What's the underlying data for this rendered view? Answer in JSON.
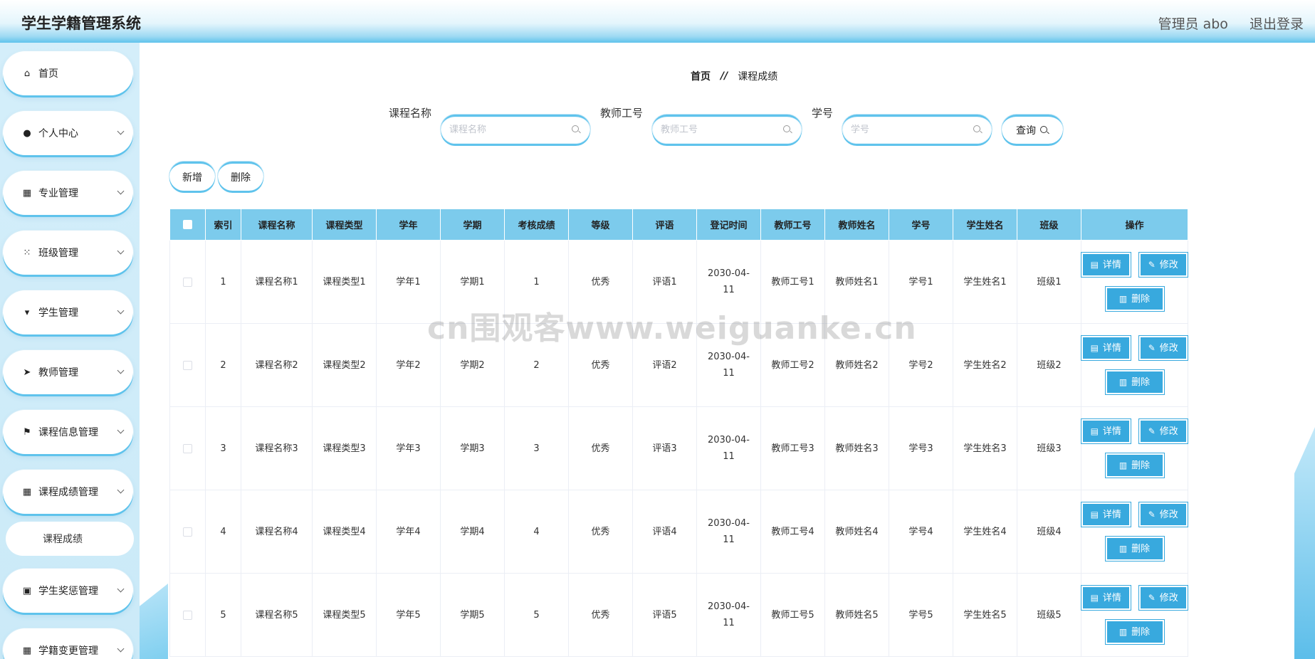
{
  "header": {
    "title": "学生学籍管理系统",
    "user_label": "管理员 abo",
    "logout_label": "退出登录"
  },
  "sidebar": {
    "items": [
      {
        "label": "首页",
        "icon": "home-icon",
        "has_submenu": false
      },
      {
        "label": "个人中心",
        "icon": "user-icon",
        "has_submenu": true
      },
      {
        "label": "专业管理",
        "icon": "grid-icon",
        "has_submenu": true
      },
      {
        "label": "班级管理",
        "icon": "grid-dots-icon",
        "has_submenu": true
      },
      {
        "label": "学生管理",
        "icon": "sign-icon",
        "has_submenu": true
      },
      {
        "label": "教师管理",
        "icon": "send-icon",
        "has_submenu": true
      },
      {
        "label": "课程信息管理",
        "icon": "flag-icon",
        "has_submenu": true
      },
      {
        "label": "课程成绩管理",
        "icon": "grid-icon",
        "has_submenu": true
      },
      {
        "label": "学生奖惩管理",
        "icon": "clipboard-icon",
        "has_submenu": true
      },
      {
        "label": "学籍变更管理",
        "icon": "grid-icon",
        "has_submenu": true
      }
    ],
    "active_sub": {
      "label": "课程成绩"
    }
  },
  "breadcrumb": {
    "home": "首页",
    "separator": "//",
    "current": "课程成绩"
  },
  "search": {
    "course_name": {
      "label": "课程名称",
      "placeholder": "课程名称",
      "value": ""
    },
    "teacher_id": {
      "label": "教师工号",
      "placeholder": "教师工号",
      "value": ""
    },
    "student_id": {
      "label": "学号",
      "placeholder": "学号",
      "value": ""
    },
    "query_label": "查询"
  },
  "actions": {
    "add_label": "新增",
    "delete_label": "删除"
  },
  "table": {
    "columns": [
      "索引",
      "课程名称",
      "课程类型",
      "学年",
      "学期",
      "考核成绩",
      "等级",
      "评语",
      "登记时间",
      "教师工号",
      "教师姓名",
      "学号",
      "学生姓名",
      "班级",
      "操作"
    ],
    "rows": [
      {
        "index": "1",
        "course": "课程名称1",
        "type": "课程类型1",
        "year": "学年1",
        "term": "学期1",
        "score": "1",
        "grade": "优秀",
        "comment": "评语1",
        "date_a": "2030-04-",
        "date_b": "11",
        "tid": "教师工号1",
        "tname": "教师姓名1",
        "sid": "学号1",
        "sname": "学生姓名1",
        "cls": "班级1"
      },
      {
        "index": "2",
        "course": "课程名称2",
        "type": "课程类型2",
        "year": "学年2",
        "term": "学期2",
        "score": "2",
        "grade": "优秀",
        "comment": "评语2",
        "date_a": "2030-04-",
        "date_b": "11",
        "tid": "教师工号2",
        "tname": "教师姓名2",
        "sid": "学号2",
        "sname": "学生姓名2",
        "cls": "班级2"
      },
      {
        "index": "3",
        "course": "课程名称3",
        "type": "课程类型3",
        "year": "学年3",
        "term": "学期3",
        "score": "3",
        "grade": "优秀",
        "comment": "评语3",
        "date_a": "2030-04-",
        "date_b": "11",
        "tid": "教师工号3",
        "tname": "教师姓名3",
        "sid": "学号3",
        "sname": "学生姓名3",
        "cls": "班级3"
      },
      {
        "index": "4",
        "course": "课程名称4",
        "type": "课程类型4",
        "year": "学年4",
        "term": "学期4",
        "score": "4",
        "grade": "优秀",
        "comment": "评语4",
        "date_a": "2030-04-",
        "date_b": "11",
        "tid": "教师工号4",
        "tname": "教师姓名4",
        "sid": "学号4",
        "sname": "学生姓名4",
        "cls": "班级4"
      },
      {
        "index": "5",
        "course": "课程名称5",
        "type": "课程类型5",
        "year": "学年5",
        "term": "学期5",
        "score": "5",
        "grade": "优秀",
        "comment": "评语5",
        "date_a": "2030-04-",
        "date_b": "11",
        "tid": "教师工号5",
        "tname": "教师姓名5",
        "sid": "学号5",
        "sname": "学生姓名5",
        "cls": "班级5"
      }
    ],
    "row_actions": {
      "detail": "详情",
      "edit": "修改",
      "delete": "删除"
    }
  },
  "watermark": "cn围观客www.weiguanke.cn",
  "colors": {
    "accent": "#5fc3ec",
    "header_row": "#7ccbec",
    "button": "#38a9de"
  }
}
